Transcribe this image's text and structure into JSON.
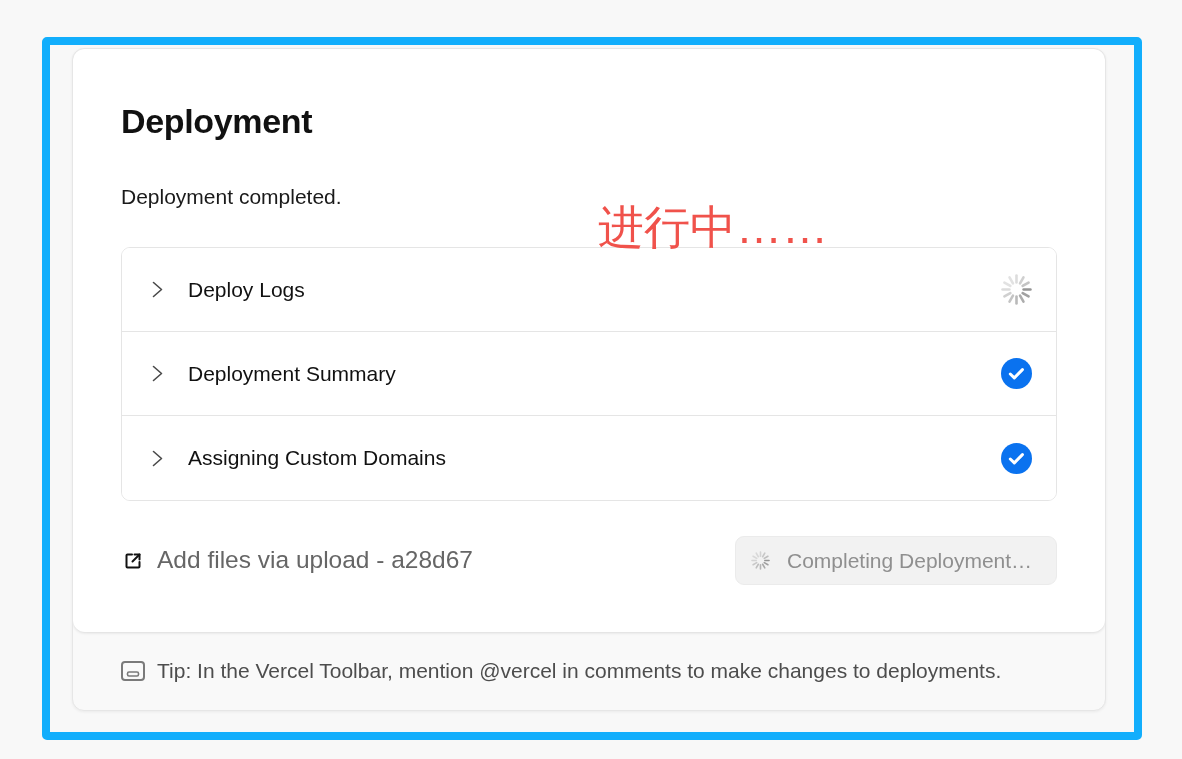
{
  "annotation": {
    "text": "进行中……"
  },
  "card": {
    "title": "Deployment",
    "status_message": "Deployment completed.",
    "steps": [
      {
        "label": "Deploy Logs",
        "expanded": false,
        "kind": "loading"
      },
      {
        "label": "Deployment Summary",
        "expanded": false,
        "kind": "done"
      },
      {
        "label": "Assigning Custom Domains",
        "expanded": false,
        "kind": "done"
      }
    ],
    "commit_link": {
      "text": "Add files via upload - a28d67"
    },
    "button": {
      "label": "Completing Deployment…",
      "disabled": true,
      "loading": true
    },
    "tip": {
      "text": "Tip: In the Vercel Toolbar, mention @vercel in comments to make changes to deployments."
    }
  }
}
